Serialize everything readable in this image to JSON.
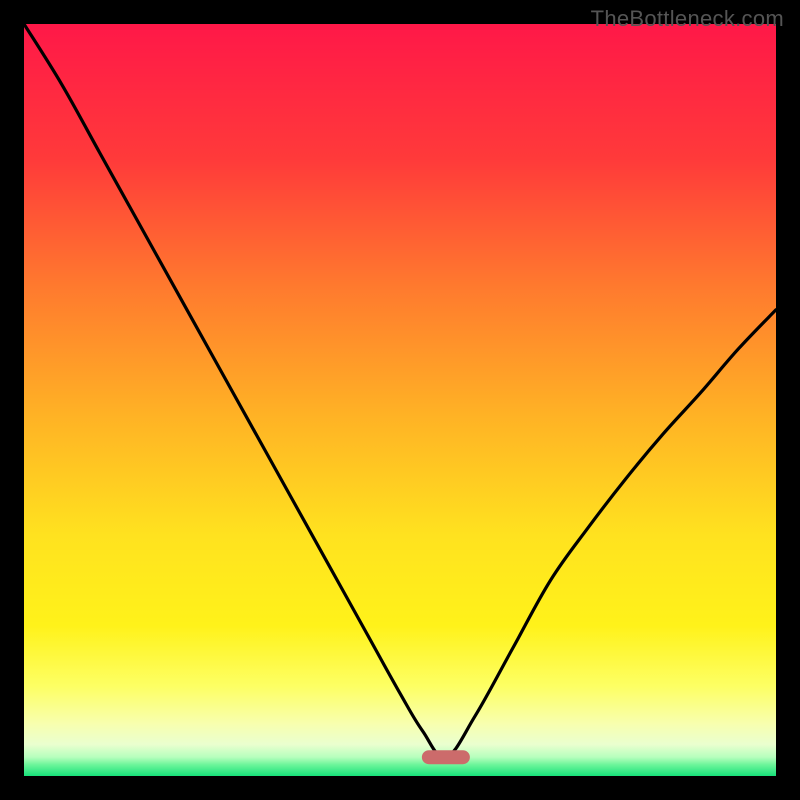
{
  "watermark": "TheBottleneck.com",
  "gradient_stops": [
    {
      "offset": 0.0,
      "color": "#ff1848"
    },
    {
      "offset": 0.18,
      "color": "#ff3a3a"
    },
    {
      "offset": 0.35,
      "color": "#ff7a2e"
    },
    {
      "offset": 0.52,
      "color": "#ffb225"
    },
    {
      "offset": 0.68,
      "color": "#ffe21f"
    },
    {
      "offset": 0.8,
      "color": "#fff21a"
    },
    {
      "offset": 0.88,
      "color": "#fdff63"
    },
    {
      "offset": 0.93,
      "color": "#f8ffae"
    },
    {
      "offset": 0.958,
      "color": "#eaffcf"
    },
    {
      "offset": 0.975,
      "color": "#b6ffbd"
    },
    {
      "offset": 0.985,
      "color": "#6cf59a"
    },
    {
      "offset": 1.0,
      "color": "#17e17a"
    }
  ],
  "marker": {
    "x_frac": 0.561,
    "y_frac": 0.975,
    "width": 48,
    "height": 14,
    "fill": "#cc6b6b",
    "rx": 7
  },
  "chart_data": {
    "type": "line",
    "title": "",
    "xlabel": "",
    "ylabel": "",
    "xlim": [
      0,
      1
    ],
    "ylim": [
      0,
      1
    ],
    "series": [
      {
        "name": "curve",
        "color": "#000000",
        "x": [
          0.0,
          0.05,
          0.1,
          0.15,
          0.2,
          0.25,
          0.3,
          0.35,
          0.4,
          0.45,
          0.5,
          0.53,
          0.561,
          0.6,
          0.65,
          0.7,
          0.75,
          0.8,
          0.85,
          0.9,
          0.95,
          1.0
        ],
        "y": [
          1.0,
          0.92,
          0.83,
          0.74,
          0.65,
          0.56,
          0.47,
          0.38,
          0.29,
          0.2,
          0.11,
          0.06,
          0.025,
          0.08,
          0.17,
          0.26,
          0.33,
          0.395,
          0.455,
          0.51,
          0.568,
          0.62
        ]
      }
    ]
  }
}
